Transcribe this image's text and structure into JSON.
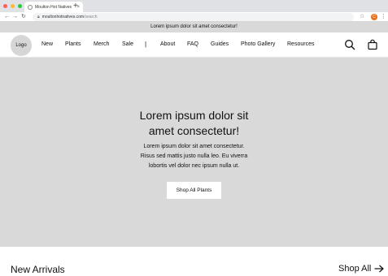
{
  "browser": {
    "tab_title": "Moulton Hot Natives",
    "tab_close": "×",
    "new_tab": "+",
    "url_host": "moultonhotnatives.com",
    "url_path": "/search",
    "profile_initial": "C",
    "traffic_colors": [
      "#fe5f57",
      "#febc2e",
      "#28c840"
    ]
  },
  "announcement": "Lorem ipsum dolor sit amet consectetur!",
  "header": {
    "logo": "Logo",
    "nav": [
      "New",
      "Plants",
      "Merch",
      "Sale",
      "About",
      "FAQ",
      "Guides",
      "Photo Gallery",
      "Resources"
    ],
    "separator": "|"
  },
  "hero": {
    "title_line1": "Lorem ipsum dolor sit",
    "title_line2": "amet consectetur!",
    "body_line1": "Lorem ipsum dolor sit amet consectetur.",
    "body_line2": "Risus sed mattis justo nulla leo. Eu viverra",
    "body_line3": "lobortis vel dolor nec ipsum nulla ut.",
    "button": "Shop All Plants"
  },
  "new_arrivals": {
    "title": "New Arrivals",
    "link": "Shop All"
  }
}
